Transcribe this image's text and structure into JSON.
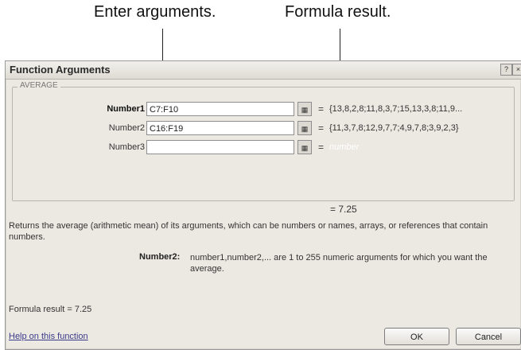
{
  "callouts": {
    "arguments": "Enter arguments.",
    "result": "Formula result."
  },
  "dialog": {
    "title": "Function Arguments",
    "help_button": "?",
    "close_button": "×",
    "function_name": "AVERAGE",
    "arguments": [
      {
        "label": "Number1",
        "value": "C7:F10",
        "result": "{13,8,2,8;11,8,3,7;15,13,3,8;11,9..."
      },
      {
        "label": "Number2",
        "value": "C16:F19",
        "result": "{11,3,7,8;12,9,7,7;4,9,7,8;3,9,2,3}"
      },
      {
        "label": "Number3",
        "value": "",
        "result": "number"
      }
    ],
    "result_equals": "=",
    "result_value": "7.25",
    "description": "Returns the average (arithmetic mean) of its arguments, which can be numbers or names, arrays, or references that contain numbers.",
    "help_arg_label": "Number2:",
    "help_arg_text": "number1,number2,... are 1 to 255 numeric arguments for which you want the average.",
    "formula_result": "Formula result =  7.25",
    "help_link": "Help on this function",
    "ok_button": "OK",
    "cancel_button": "Cancel"
  }
}
